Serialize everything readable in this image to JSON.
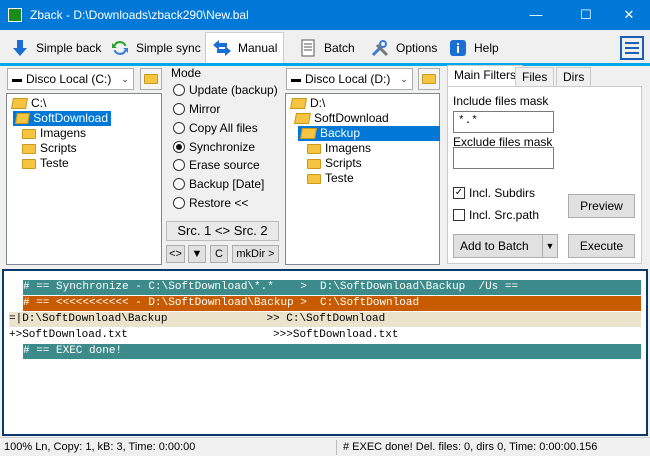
{
  "window": {
    "title": "Zback - D:\\Downloads\\zback290\\New.bal",
    "minimize": "—",
    "maximize": "☐",
    "close": "✕"
  },
  "toolbar": {
    "items": [
      {
        "label": "Simple back",
        "icon": "down-arrow-icon",
        "color": "#1a6fd4"
      },
      {
        "label": "Simple sync",
        "icon": "sync-icon",
        "color": "#2ca02c"
      },
      {
        "label": "Manual",
        "icon": "left-right-arrows-icon",
        "color": "#1a6fd4"
      },
      {
        "label": "Batch",
        "icon": "document-icon",
        "color": "#555555"
      },
      {
        "label": "Options",
        "icon": "tools-icon",
        "color": "#3a7bd5"
      },
      {
        "label": "Help",
        "icon": "info-icon",
        "color": "#1a6fd4"
      }
    ],
    "menu_icon": "hamburger-menu-icon"
  },
  "source": {
    "drive": "Disco Local (C:)",
    "tree": [
      "C:\\",
      "SoftDownload",
      "Imagens",
      "Scripts",
      "Teste"
    ],
    "selected": "SoftDownload"
  },
  "mode": {
    "title": "Mode",
    "options": [
      "Update (backup)",
      "Mirror",
      "Copy All files",
      "Synchronize",
      "Erase source",
      "Backup [Date]",
      "Restore <<"
    ],
    "selected": "Synchronize",
    "swap_label": "Src. 1 <> Src. 2",
    "buttons": [
      "<>",
      "▼",
      "C",
      "mkDir >"
    ]
  },
  "dest": {
    "drive": "Disco Local (D:)",
    "tree": [
      "D:\\",
      "SoftDownload",
      "Backup",
      "Imagens",
      "Scripts",
      "Teste"
    ],
    "selected": "Backup"
  },
  "filters": {
    "tabs": [
      "Main Filters",
      "Files",
      "Dirs"
    ],
    "include_label": "Include files mask",
    "include_value": "*.*",
    "exclude_label": "Exclude files mask",
    "exclude_value": "",
    "incl_subdirs": "Incl. Subdirs",
    "incl_srcpath": "Incl. Src.path",
    "preview": "Preview",
    "add_to_batch": "Add to Batch",
    "execute": "Execute"
  },
  "log": {
    "rows": [
      {
        "text": "# == Synchronize - C:\\SoftDownload\\*.*    >  D:\\SoftDownload\\Backup  /Us ==",
        "bg": "#3d8a8a",
        "fg": "#ffffff",
        "marker": true
      },
      {
        "text": "# == <<<<<<<<<<< - D:\\SoftDownload\\Backup >  C:\\SoftDownload",
        "bg": "#c85a00",
        "fg": "#ffffff",
        "marker": true
      },
      {
        "text": "=|D:\\SoftDownload\\Backup               >> C:\\SoftDownload",
        "bg": "#ece3cc",
        "fg": "#000000",
        "marker": false
      },
      {
        "text": "+>SoftDownload.txt                      >>>SoftDownload.txt",
        "bg": "#ffffff",
        "fg": "#000000",
        "marker": false
      },
      {
        "text": "# == EXEC done!",
        "bg": "#3d8a8a",
        "fg": "#ffffff",
        "marker": true
      }
    ]
  },
  "status": {
    "left": "100% Ln, Copy: 1, kB: 3, Time: 0:00:00",
    "right": "# EXEC done! Del. files: 0,  dirs 0,  Time: 0:00:00.156"
  }
}
